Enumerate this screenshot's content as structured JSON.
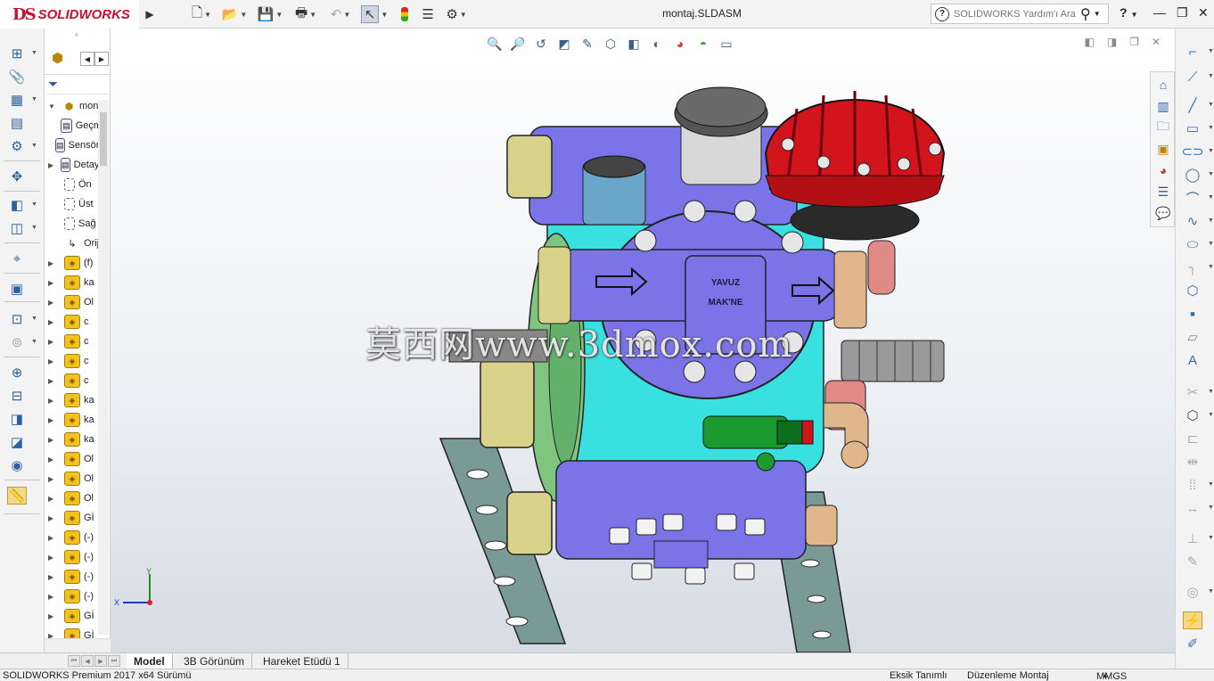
{
  "app": {
    "brand": "SOLIDWORKS",
    "brand_prefix": "DS",
    "doc_title": "montaj.SLDASM",
    "help_search_placeholder": "SOLIDWORKS Yardım'ı Ara",
    "help_label": "?"
  },
  "toolbar": {
    "icons": [
      "new-document-icon",
      "open-icon",
      "save-icon",
      "print-icon",
      "undo-icon",
      "select-icon",
      "rebuild-icon",
      "file-properties-icon",
      "options-icon"
    ]
  },
  "heads_up": {
    "icons": [
      "zoom-to-fit-icon",
      "zoom-to-area-icon",
      "previous-view-icon",
      "section-view-icon",
      "dynamic-annotation-icon",
      "view-orientation-icon",
      "display-style-icon",
      "hide-show-icon",
      "edit-appearance-icon",
      "apply-scene-icon",
      "view-settings-icon"
    ]
  },
  "tree": {
    "items": [
      {
        "label": "montaj",
        "kind": "assembly",
        "expand": "▼"
      },
      {
        "label": "Geçmiş",
        "kind": "folder",
        "expand": ""
      },
      {
        "label": "Sensörler",
        "kind": "folder",
        "expand": ""
      },
      {
        "label": "Detaylandırmalar",
        "kind": "folder",
        "expand": "▶"
      },
      {
        "label": "Ön",
        "kind": "plane",
        "expand": ""
      },
      {
        "label": "Üst",
        "kind": "plane",
        "expand": ""
      },
      {
        "label": "Sağ",
        "kind": "plane",
        "expand": ""
      },
      {
        "label": "Orijin",
        "kind": "origin",
        "expand": ""
      },
      {
        "label": "(f)",
        "kind": "part",
        "expand": "▶"
      },
      {
        "label": "ka",
        "kind": "part",
        "expand": "▶"
      },
      {
        "label": "Ol",
        "kind": "part",
        "expand": "▶"
      },
      {
        "label": "c",
        "kind": "part",
        "expand": "▶"
      },
      {
        "label": "c",
        "kind": "part",
        "expand": "▶"
      },
      {
        "label": "c",
        "kind": "part",
        "expand": "▶"
      },
      {
        "label": "c",
        "kind": "part",
        "expand": "▶"
      },
      {
        "label": "ka",
        "kind": "part",
        "expand": "▶"
      },
      {
        "label": "ka",
        "kind": "part",
        "expand": "▶"
      },
      {
        "label": "ka",
        "kind": "part",
        "expand": "▶"
      },
      {
        "label": "Ol",
        "kind": "part",
        "expand": "▶"
      },
      {
        "label": "Ol",
        "kind": "part",
        "expand": "▶"
      },
      {
        "label": "Ol",
        "kind": "part",
        "expand": "▶"
      },
      {
        "label": "Gİ",
        "kind": "part",
        "expand": "▶"
      },
      {
        "label": "(-)",
        "kind": "part",
        "expand": "▶"
      },
      {
        "label": "(-)",
        "kind": "part",
        "expand": "▶"
      },
      {
        "label": "(-)",
        "kind": "part",
        "expand": "▶"
      },
      {
        "label": "(-)",
        "kind": "part",
        "expand": "▶"
      },
      {
        "label": "Gİ",
        "kind": "part",
        "expand": "▶"
      },
      {
        "label": "Gİ",
        "kind": "part",
        "expand": "▶"
      }
    ]
  },
  "viewport": {
    "watermark": "莫西网www.3dmox.com",
    "pump_label_1": "YAVUZ",
    "pump_label_2": "MAK'NE",
    "triad_y": "Y",
    "triad_x": "X"
  },
  "tabs": [
    {
      "label": "Model",
      "active": true
    },
    {
      "label": "3B Görünüm",
      "active": false
    },
    {
      "label": "Hareket Etüdü 1",
      "active": false
    }
  ],
  "status": {
    "product": "SOLIDWORKS Premium 2017 x64 Sürümü",
    "definition": "Eksik Tanımlı",
    "mode": "Düzenleme Montaj",
    "units": "MMGS",
    "units_arrow": "▲"
  },
  "colors": {
    "brand_red": "#c8102e",
    "pump_body": "#7b74e8",
    "pump_cyan": "#38e0e0",
    "bracket": "#7a9a96",
    "cap_red": "#d2141c",
    "fitting_tan": "#e0b78c"
  }
}
